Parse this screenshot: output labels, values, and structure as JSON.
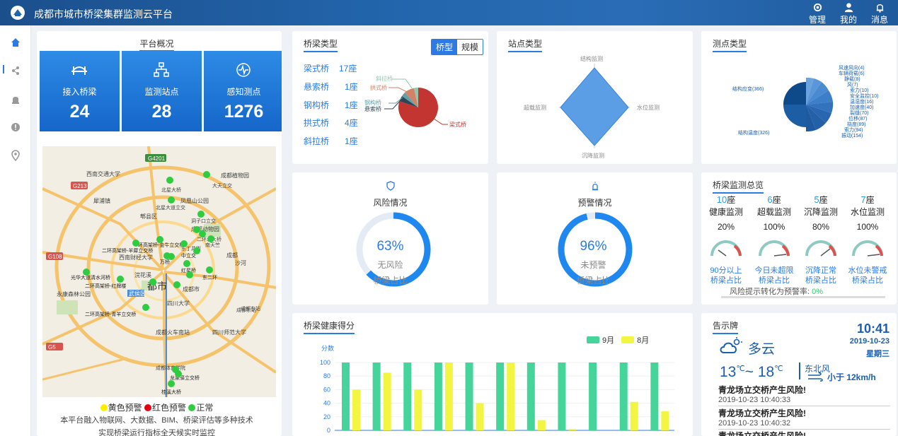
{
  "header": {
    "title": "成都市城市桥梁集群监测云平台",
    "actions": [
      {
        "label": "管理",
        "icon": "gear-icon"
      },
      {
        "label": "我的",
        "icon": "user-icon"
      },
      {
        "label": "消息",
        "icon": "bell-icon"
      }
    ]
  },
  "sidebar": {
    "items": [
      {
        "icon": "home-icon",
        "active": true
      },
      {
        "icon": "share-icon"
      },
      {
        "icon": "alarm-icon"
      },
      {
        "icon": "warning-icon"
      },
      {
        "icon": "location-pin-icon"
      }
    ]
  },
  "overview": {
    "title": "平台概况",
    "stats": [
      {
        "label": "接入桥梁",
        "value": "24"
      },
      {
        "label": "监测站点",
        "value": "28"
      },
      {
        "label": "感知测点",
        "value": "1276"
      }
    ],
    "legend": [
      {
        "label": "黄色预警",
        "color": "#ffee00"
      },
      {
        "label": "红色预警",
        "color": "#e60012"
      },
      {
        "label": "正常",
        "color": "#2ecc40"
      }
    ],
    "desc1": "本平台融入物联网、大数据、BIM、桥梁评估等多种技术",
    "desc2": "实现桥梁运行指标全天候实时监控",
    "map": {
      "labels": [
        "西南交通大学",
        "成都植物园",
        "大天立交",
        "北星大桥",
        "凤凰山公园",
        "北星大道立交",
        "犀浦镇",
        "郫县区",
        "成都动物园",
        "洞子口立交",
        "二环北大桥",
        "南天竺",
        "东丁井街",
        "二环高架桥-羊犀立交桥",
        "一环高架桥-金牛立交桥",
        "西南财经大学",
        "中立交",
        "成都",
        "万桥",
        "沙河",
        "成都东站",
        "浣花溪",
        "红星桥",
        "光华大道清水河桥",
        "东二环",
        "二环高架桥-红牌楼",
        "都市",
        "武侯区",
        "成都市",
        "永康森林公园",
        "四川大学",
        "二环高架桥-青羊立交桥",
        "成都东站",
        "成都火车南站",
        "四川师范大学",
        "龙泉驿立交桥",
        "成都体育学院",
        "桂溪大桥",
        "G4201",
        "G213",
        "G108",
        "G5"
      ]
    }
  },
  "bridge_type": {
    "title": "桥梁类型",
    "toggle": [
      {
        "label": "桥型",
        "active": true
      },
      {
        "label": "规模",
        "active": false
      }
    ],
    "items": [
      {
        "name": "梁式桥",
        "count": "17座"
      },
      {
        "name": "悬索桥",
        "count": "1座"
      },
      {
        "name": "钢构桥",
        "count": "1座"
      },
      {
        "name": "拱式桥",
        "count": "4座"
      },
      {
        "name": "斜拉桥",
        "count": "1座"
      }
    ],
    "pie_labels": [
      "斜拉桥",
      "拱式桥",
      "钢构桥",
      "悬索桥",
      "梁式桥"
    ]
  },
  "station_type": {
    "title": "站点类型",
    "axes": [
      "结构监测",
      "水位监测",
      "沉降监测",
      "超载监测"
    ]
  },
  "point_type": {
    "title": "测点类型",
    "labels": [
      "结构应变(366)",
      "结构温度(326)",
      "风速风向(4)",
      "车辆荷载(6)",
      "静载(8)",
      "风(7)",
      "索力(10)",
      "安全监控(10)",
      "温湿度(16)",
      "加速度(40)",
      "裂缝(70)",
      "位移(87)",
      "挠度(89)",
      "索力(94)",
      "振动(154)"
    ]
  },
  "risk": {
    "title": "风险情况",
    "icon": "shield-icon",
    "percent": "63%",
    "status": "无风险",
    "caption": "桥梁占比",
    "fill": 0.63
  },
  "warning": {
    "title": "预警情况",
    "icon": "alarm-icon",
    "percent": "96%",
    "status": "未预警",
    "caption": "桥梁占比",
    "fill": 0.96
  },
  "monitor": {
    "title": "桥梁监测总览",
    "columns": [
      {
        "count": "10",
        "unit": "座",
        "name": "健康监测",
        "pct": "20%",
        "caption1": "90分以上",
        "caption2": "桥梁占比"
      },
      {
        "count": "6",
        "unit": "座",
        "name": "超载监测",
        "pct": "100%",
        "caption1": "今日未超限",
        "caption2": "桥梁占比"
      },
      {
        "count": "5",
        "unit": "座",
        "name": "沉降监测",
        "pct": "80%",
        "caption1": "沉降正常",
        "caption2": "桥梁占比"
      },
      {
        "count": "7",
        "unit": "座",
        "name": "水位监测",
        "pct": "100%",
        "caption1": "水位未警戒",
        "caption2": "桥梁占比"
      }
    ],
    "risk_text": "风险提示转化为预警率:",
    "risk_value": "0%"
  },
  "health": {
    "title": "桥梁健康得分",
    "chart_data": {
      "type": "bar",
      "ylabel": "分数",
      "ylim": [
        0,
        100
      ],
      "yticks": [
        0,
        20,
        40,
        60,
        80,
        100
      ],
      "categories": [
        "",
        "",
        "",
        "",
        "",
        "",
        "",
        "",
        "",
        "",
        ""
      ],
      "series": [
        {
          "name": "9月",
          "color": "#45d49a",
          "values": [
            100,
            100,
            100,
            100,
            100,
            100,
            100,
            100,
            100,
            100,
            100
          ]
        },
        {
          "name": "8月",
          "color": "#f2f542",
          "values": [
            60,
            85,
            60,
            100,
            40,
            100,
            15,
            2,
            0,
            42,
            28
          ]
        }
      ]
    }
  },
  "notice": {
    "title": "告示牌",
    "time": "10:41",
    "date": "2019-10-23",
    "weekday": "星期三",
    "weather": "多云",
    "temp_low": "13",
    "temp_high": "18",
    "temp_unit": "℃",
    "temp_sep": "~",
    "wind_dir": "东北风",
    "wind_speed": "小于 12km/h",
    "news": [
      {
        "title": "青龙场立交桥产生风险!",
        "time": "2019-10-23 10:40:33"
      },
      {
        "title": "青龙场立交桥产生风险!",
        "time": "2019-10-23 10:40:32"
      },
      {
        "title": "青龙场立交桥产生风险!",
        "time": ""
      }
    ]
  }
}
